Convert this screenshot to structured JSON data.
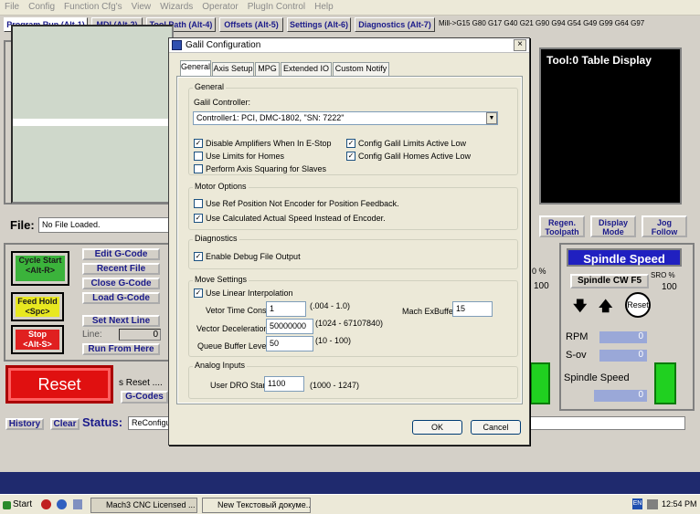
{
  "menu": [
    "File",
    "Config",
    "Function Cfg's",
    "View",
    "Wizards",
    "Operator",
    "PlugIn Control",
    "Help"
  ],
  "tabs": [
    {
      "label": "Program Run (Alt-1)"
    },
    {
      "label": "MDI (Alt-2)"
    },
    {
      "label": "Tool Path (Alt-4)"
    },
    {
      "label": "Offsets (Alt-5)"
    },
    {
      "label": "Settings (Alt-6)"
    },
    {
      "label": "Diagnostics (Alt-7)"
    }
  ],
  "gcode_modes": "Mill->G15  G80 G17 G40 G21 G90 G94 G54 G49 G99 G64 G97",
  "tool_display": "Tool:0   Table Display",
  "file": {
    "label": "File:",
    "value": "No File Loaded."
  },
  "buttons": {
    "edit_gcode": "Edit G-Code",
    "recent_file": "Recent File",
    "close_gcode": "Close G-Code",
    "load_gcode": "Load G-Code",
    "set_next_line": "Set Next Line",
    "line_label": "Line:",
    "line_value": "0",
    "run_from_here": "Run From Here",
    "cycle_start": "Cycle Start",
    "cycle_start_key": "<Alt-R>",
    "feed_hold": "Feed Hold",
    "feed_hold_key": "<Spc>",
    "stop": "Stop",
    "stop_key": "<Alt-S>",
    "reset": "Reset",
    "reset_note": "s Reset ....",
    "gcodes": "G-Codes",
    "regen": "Regen.",
    "toolpath": "Toolpath",
    "display": "Display",
    "mode": "Mode",
    "jog": "Jog",
    "follow": "Follow",
    "history": "History",
    "clear": "Clear"
  },
  "status": {
    "label": "Status:",
    "value": "ReConfigu"
  },
  "spindle": {
    "title": "Spindle Speed",
    "cw": "Spindle CW F5",
    "sro_label": "SRO %",
    "sro_value": "100",
    "reset": "Reset",
    "rpm_label": "RPM",
    "rpm_value": "0",
    "sov_label": "S-ov",
    "sov_value": "0",
    "speed_label": "Spindle Speed",
    "speed_value": "0"
  },
  "left_partial": {
    "pct": "0 %",
    "val": "100"
  },
  "dialog": {
    "title": "Galil Configuration",
    "tabs": [
      "General",
      "Axis Setup",
      "MPG",
      "Extended IO",
      "Custom Notify"
    ],
    "general": {
      "group": "General",
      "controller_label": "Galil Controller:",
      "controller_value": "Controller1: PCI, DMC-1802, \"SN: 7222\"",
      "checks": [
        {
          "label": "Disable Amplifiers When In E-Stop",
          "checked": "✓"
        },
        {
          "label": "Config Galil Limits Active Low",
          "checked": "✓"
        },
        {
          "label": "Use Limits for Homes",
          "checked": ""
        },
        {
          "label": "Config Galil Homes Active Low",
          "checked": "✓"
        },
        {
          "label": "Perform Axis Squaring for Slaves",
          "checked": ""
        }
      ]
    },
    "motor": {
      "group": "Motor Options",
      "checks": [
        {
          "label": "Use Ref Position Not Encoder for Position Feedback.",
          "checked": ""
        },
        {
          "label": "Use Calculated Actual Speed Instead of Encoder.",
          "checked": "✓"
        }
      ]
    },
    "diagnostics": {
      "group": "Diagnostics",
      "check": {
        "label": "Enable Debug File Output",
        "checked": "✓"
      }
    },
    "move": {
      "group": "Move Settings",
      "linear": {
        "label": "Use Linear Interpolation",
        "checked": "✓"
      },
      "vtc_label": "Vetor Time Const",
      "vtc_value": "1",
      "vtc_range": "(.004 - 1.0)",
      "exbuf_label": "Mach ExBuffer",
      "exbuf_value": "15",
      "decel_label": "Vector Deceleration",
      "decel_value": "50000000",
      "decel_range": "(1024 - 67107840)",
      "queue_label": "Queue Buffer Level",
      "queue_value": "50",
      "queue_range": "(10 - 100)"
    },
    "analog": {
      "group": "Analog Inputs",
      "dro_label": "User DRO Start",
      "dro_value": "1100",
      "dro_range": "(1000 - 1247)"
    },
    "ok": "OK",
    "cancel": "Cancel"
  },
  "taskbar": {
    "start": "Start",
    "app1": "Mach3 CNC  Licensed ...",
    "app2": "New Текстовый докуме...",
    "lang": "EN",
    "clock": "12:54 PM"
  }
}
